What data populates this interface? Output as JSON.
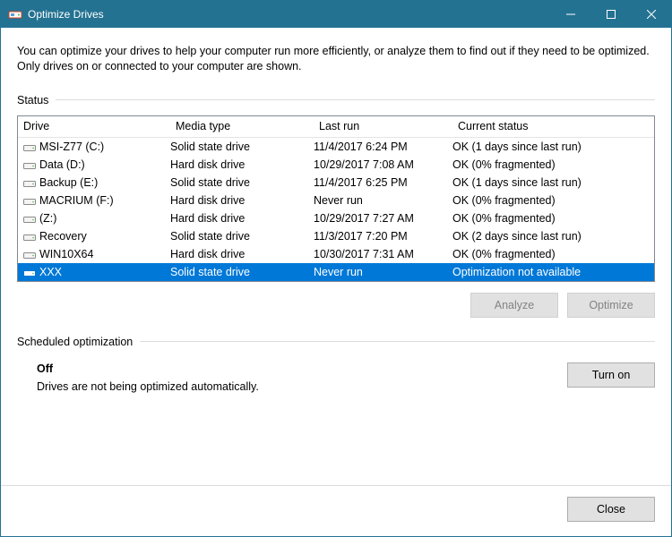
{
  "window": {
    "title": "Optimize Drives"
  },
  "intro": "You can optimize your drives to help your computer run more efficiently, or analyze them to find out if they need to be optimized. Only drives on or connected to your computer are shown.",
  "status": {
    "label": "Status",
    "columns": {
      "drive": "Drive",
      "media": "Media type",
      "last": "Last run",
      "status": "Current status"
    },
    "rows": [
      {
        "drive": "MSI-Z77 (C:)",
        "media": "Solid state drive",
        "last": "11/4/2017 6:24 PM",
        "status": "OK (1 days since last run)",
        "selected": false
      },
      {
        "drive": "Data (D:)",
        "media": "Hard disk drive",
        "last": "10/29/2017 7:08 AM",
        "status": "OK (0% fragmented)",
        "selected": false
      },
      {
        "drive": "Backup (E:)",
        "media": "Solid state drive",
        "last": "11/4/2017 6:25 PM",
        "status": "OK (1 days since last run)",
        "selected": false
      },
      {
        "drive": "MACRIUM (F:)",
        "media": "Hard disk drive",
        "last": "Never run",
        "status": "OK (0% fragmented)",
        "selected": false
      },
      {
        "drive": "(Z:)",
        "media": "Hard disk drive",
        "last": "10/29/2017 7:27 AM",
        "status": "OK (0% fragmented)",
        "selected": false
      },
      {
        "drive": "Recovery",
        "media": "Solid state drive",
        "last": "11/3/2017 7:20 PM",
        "status": "OK (2 days since last run)",
        "selected": false
      },
      {
        "drive": "WIN10X64",
        "media": "Hard disk drive",
        "last": "10/30/2017 7:31 AM",
        "status": "OK (0% fragmented)",
        "selected": false
      },
      {
        "drive": "XXX",
        "media": "Solid state drive",
        "last": "Never run",
        "status": "Optimization not available",
        "selected": true
      }
    ]
  },
  "buttons": {
    "analyze": "Analyze",
    "optimize": "Optimize",
    "turn_on": "Turn on",
    "close": "Close"
  },
  "scheduled": {
    "label": "Scheduled optimization",
    "state": "Off",
    "desc": "Drives are not being optimized automatically."
  }
}
